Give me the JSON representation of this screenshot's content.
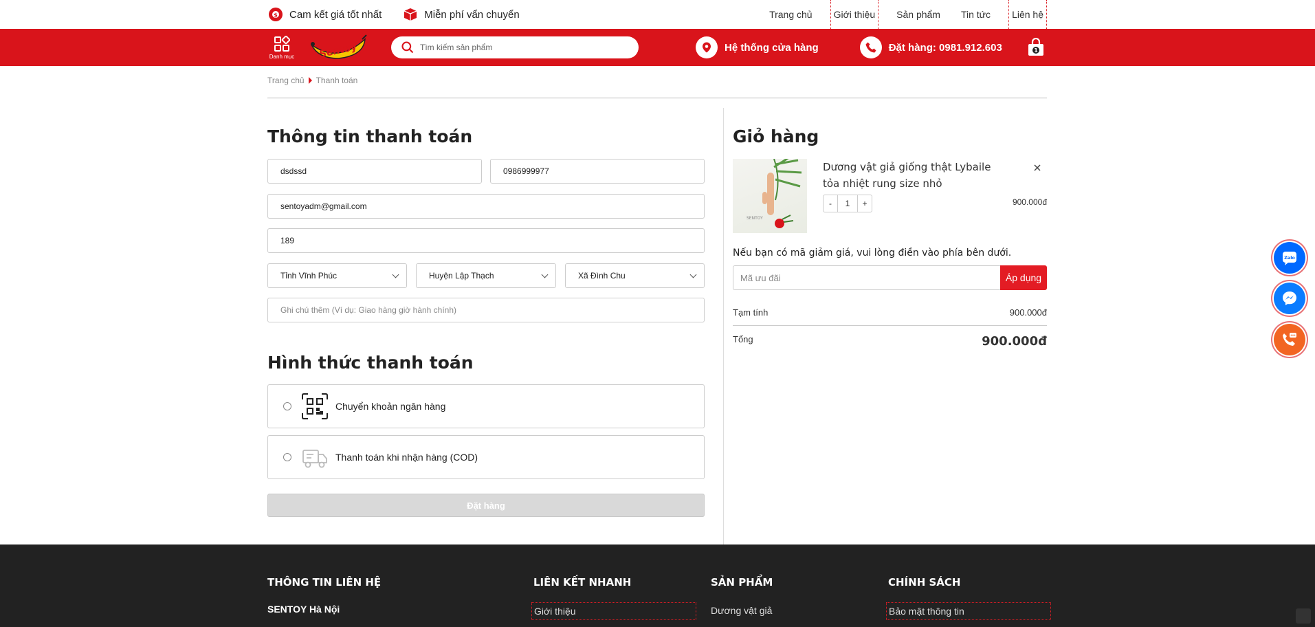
{
  "topbar": {
    "promo": [
      {
        "icon": "price-guarantee-icon",
        "label": "Cam kết giá tốt nhất"
      },
      {
        "icon": "free-shipping-box-icon",
        "label": "Miễn phí vẩn chuyển"
      }
    ],
    "nav": [
      {
        "label": "Trang chủ"
      },
      {
        "label": "Giới thiệu"
      },
      {
        "label": "Sản phẩm"
      },
      {
        "label": "Tin tức"
      },
      {
        "label": "Liên hệ"
      }
    ]
  },
  "header": {
    "menu_label": "Danh mục",
    "logo_text": "Sentoy",
    "search_placeholder": "Tìm kiếm sản phẩm",
    "stores_label": "Hệ thống cửa hàng",
    "phone_label": "Đặt hàng: 0981.912.603",
    "cart_count": "1",
    "brand_color": "#d9141b"
  },
  "breadcrumb": {
    "home": "Trang chủ",
    "current": "Thanh toán"
  },
  "billing": {
    "title": "Thông tin thanh toán",
    "name": "dsdssd",
    "phone": "0986999977",
    "email": "sentoyadm@gmail.com",
    "address": "189",
    "province": "Tỉnh Vĩnh Phúc",
    "district": "Huyện Lập Thạch",
    "ward": "Xã Đình Chu",
    "note_placeholder": "Ghi chú thêm (Ví dụ: Giao hàng giờ hành chính)"
  },
  "payment": {
    "title": "Hình thức thanh toán",
    "options": [
      {
        "icon": "qr-code-icon",
        "label": "Chuyển khoản ngân hàng"
      },
      {
        "icon": "delivery-truck-icon",
        "label": "Thanh toán khi nhận hàng (COD)"
      }
    ],
    "order_button": "Đặt hàng"
  },
  "cart": {
    "title": "Giỏ hàng",
    "item": {
      "name": "Dương vật giả giống thật Lybaile tỏa nhiệt rung size nhỏ",
      "image_brand": "SENTOY",
      "qty": "1",
      "minus": "-",
      "plus": "+",
      "price": "900.000đ"
    },
    "coupon_note": "Nếu bạn có mã giảm giá, vui lòng điền vào phía bên dưới.",
    "coupon_placeholder": "Mã ưu đãi",
    "apply_label": "Áp dụng",
    "subtotal_label": "Tạm tính",
    "subtotal": "900.000đ",
    "total_label": "Tổng",
    "total": "900.000đ"
  },
  "footer": {
    "columns": [
      {
        "title": "THÔNG TIN LIÊN HỆ",
        "item": "SENTOY Hà Nội"
      },
      {
        "title": "LIÊN KẾT NHANH",
        "item": "Giới thiệu"
      },
      {
        "title": "SẢN PHẨM",
        "item": "Dương vật giả"
      },
      {
        "title": "CHÍNH SÁCH",
        "item": "Bảo mật thông tin"
      }
    ]
  },
  "floating": [
    {
      "icon": "zalo-icon",
      "color": "#0068ff"
    },
    {
      "icon": "messenger-icon",
      "color": "#0a7cff"
    },
    {
      "icon": "phone-chat-icon",
      "color": "#f26522"
    }
  ]
}
